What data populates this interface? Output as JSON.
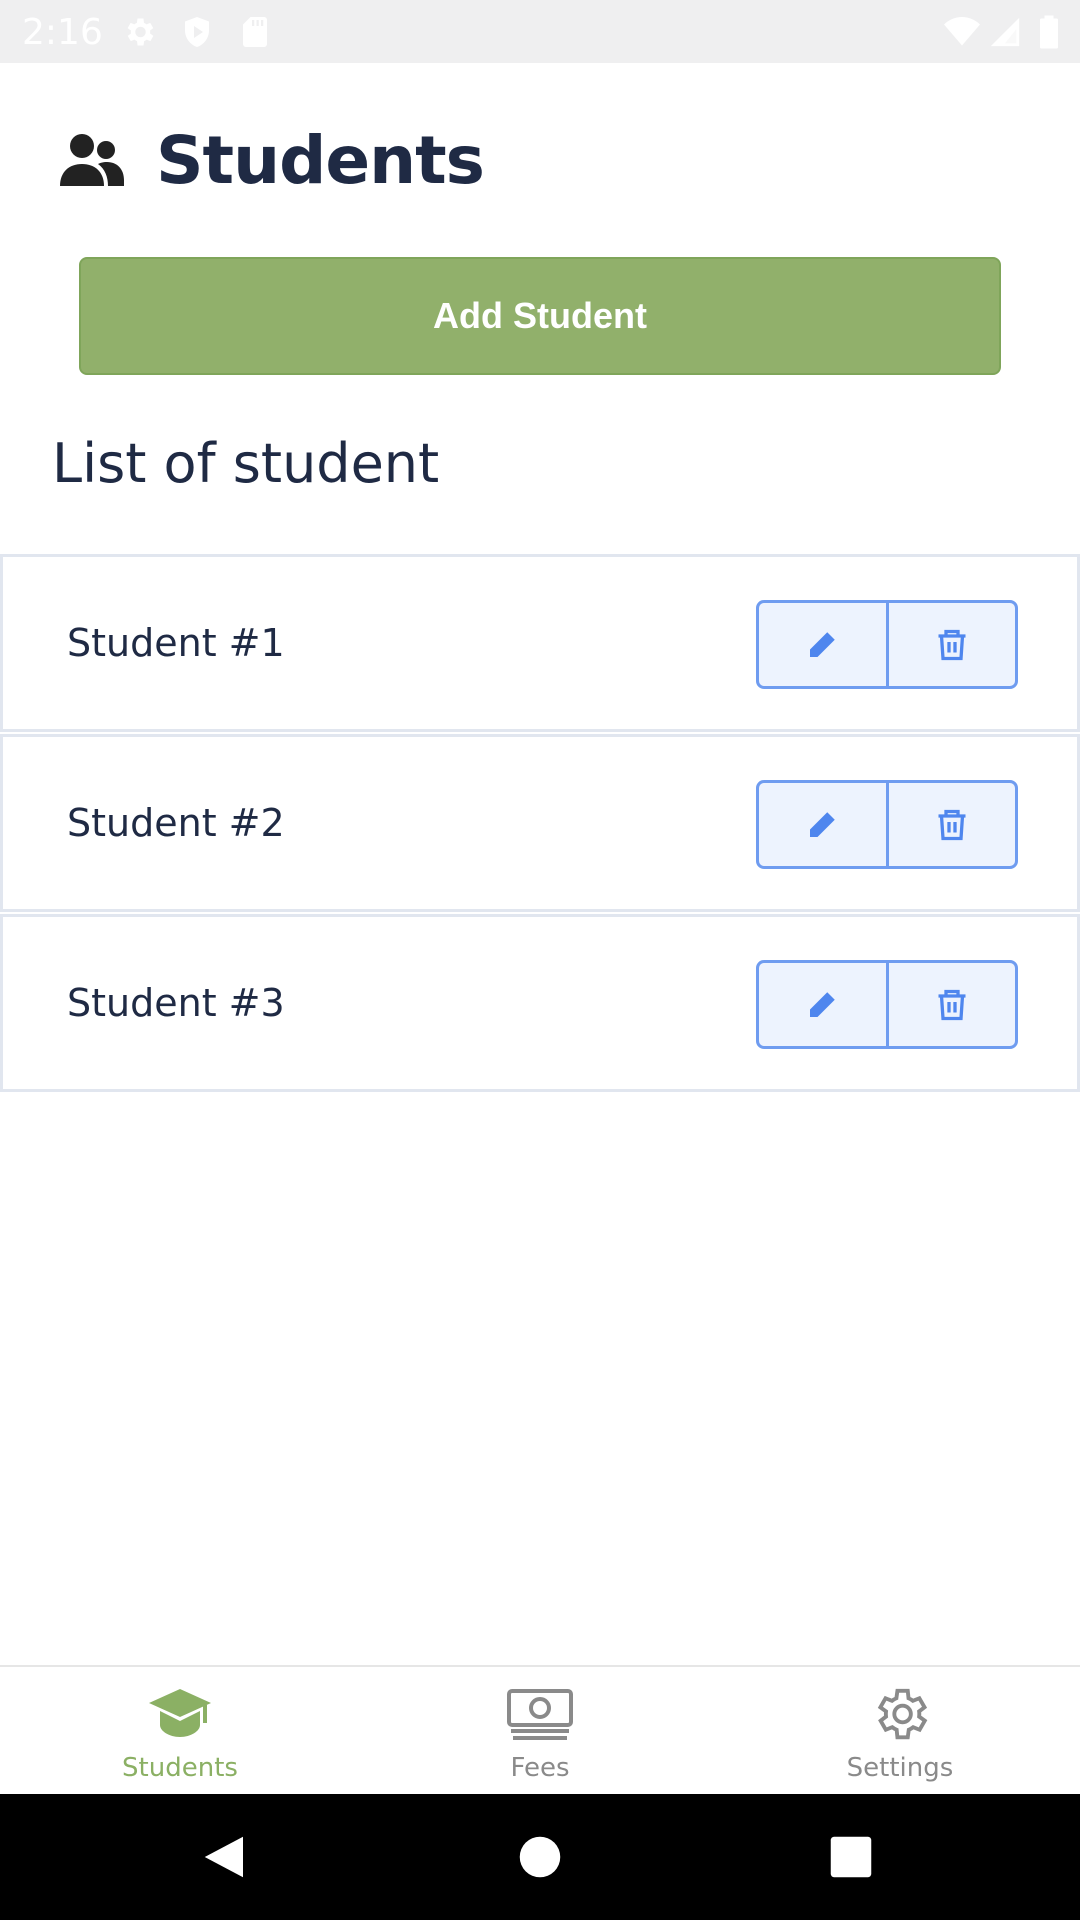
{
  "status_bar": {
    "time": "2:16",
    "icons": [
      "gear-icon",
      "shield-play-icon",
      "sd-card-icon",
      "wifi-icon",
      "signal-icon",
      "battery-icon"
    ]
  },
  "header": {
    "icon": "users-icon",
    "title": "Students"
  },
  "add_button": {
    "label": "Add Student",
    "color": "#91b06b"
  },
  "list": {
    "title": "List of student",
    "students": [
      {
        "name": "Student #1"
      },
      {
        "name": "Student #2"
      },
      {
        "name": "Student #3"
      }
    ],
    "actions": [
      "pencil-icon",
      "trash-icon"
    ],
    "action_color": "#6f9cf0"
  },
  "bottom_nav": {
    "items": [
      {
        "label": "Students",
        "icon": "graduation-cap-icon",
        "active": true
      },
      {
        "label": "Fees",
        "icon": "money-icon",
        "active": false
      },
      {
        "label": "Settings",
        "icon": "gear-icon",
        "active": false
      }
    ],
    "active_color": "#8bb064"
  },
  "system_nav": {
    "buttons": [
      "back-icon",
      "home-icon",
      "recents-icon"
    ]
  }
}
